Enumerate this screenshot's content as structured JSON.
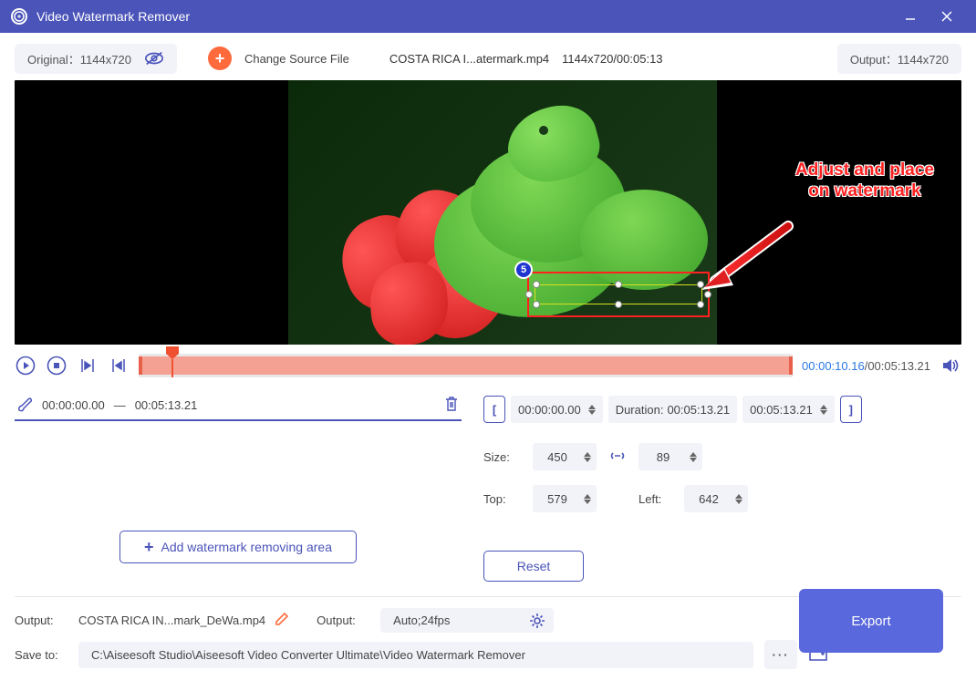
{
  "title": "Video Watermark Remover",
  "infobar": {
    "original": "Original：1144x720",
    "change_source": "Change Source File",
    "filename": "COSTA RICA I...atermark.mp4",
    "dims_time": "1144x720/00:05:13",
    "output": "Output：1144x720"
  },
  "annotation": {
    "line1": "Adjust and place",
    "line2": "on watermark",
    "badge": "5"
  },
  "playback": {
    "current": "00:00:10.16",
    "total": "/00:05:13.21"
  },
  "segment": {
    "start": "00:00:00.00",
    "sep": "—",
    "end": "00:05:13.21"
  },
  "timebox": {
    "start": "00:00:00.00",
    "dur_label": "Duration:",
    "dur": "00:05:13.21",
    "end": "00:05:13.21"
  },
  "dims": {
    "size_label": "Size:",
    "width": "450",
    "height": "89",
    "top_label": "Top:",
    "top": "579",
    "left_label": "Left:",
    "left": "642"
  },
  "buttons": {
    "add_area": "Add watermark removing area",
    "reset": "Reset",
    "export": "Export"
  },
  "output": {
    "label": "Output:",
    "name": "COSTA RICA IN...mark_DeWa.mp4",
    "fmt_label": "Output:",
    "fmt": "Auto;24fps",
    "save_label": "Save to:",
    "path": "C:\\Aiseesoft Studio\\Aiseesoft Video Converter Ultimate\\Video Watermark Remover"
  }
}
